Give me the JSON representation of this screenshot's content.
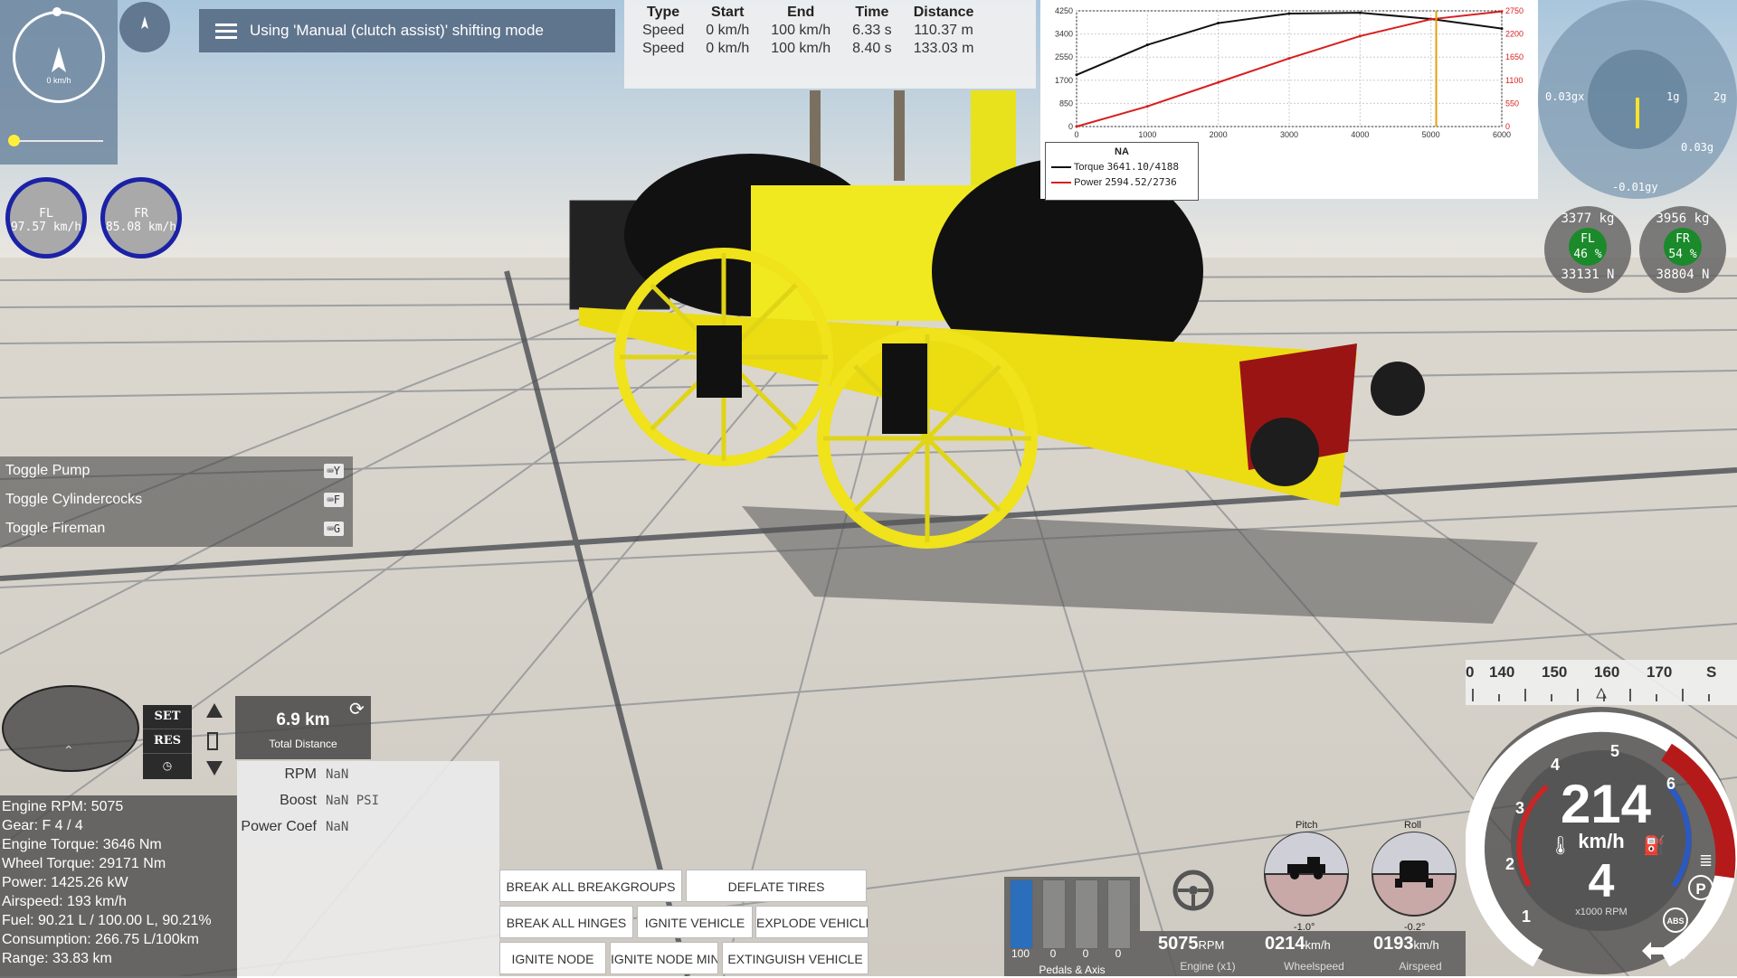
{
  "minimap": {
    "speed": "0 km/h"
  },
  "shift_banner": {
    "text": "Using 'Manual (clutch assist)' shifting mode"
  },
  "wheel_speeds": [
    {
      "label": "FL",
      "value": "97.57 km/h"
    },
    {
      "label": "FR",
      "value": "85.08 km/h"
    }
  ],
  "perf_table": {
    "headers": [
      "Type",
      "Start",
      "End",
      "Time",
      "Distance"
    ],
    "rows": [
      [
        "Speed",
        "0 km/h",
        "100 km/h",
        "6.33 s",
        "110.37 m"
      ],
      [
        "Speed",
        "0 km/h",
        "100 km/h",
        "8.40 s",
        "133.03 m"
      ]
    ]
  },
  "chart_data": {
    "type": "line",
    "title": "",
    "x": [
      0,
      1000,
      2000,
      3000,
      4000,
      5000,
      6000
    ],
    "xlim": [
      0,
      6000
    ],
    "ylim_left": [
      0,
      4250
    ],
    "ylim_right": [
      0,
      2750
    ],
    "left_ticks": [
      "4250",
      "3400",
      "2550",
      "1700",
      "850",
      "0"
    ],
    "right_ticks": [
      "2750",
      "2200",
      "1650",
      "1100",
      "550",
      "0"
    ],
    "x_ticks": [
      "0",
      "1000",
      "2000",
      "3000",
      "4000",
      "5000",
      "6000"
    ],
    "series": [
      {
        "name": "Torque",
        "color": "#111111",
        "values": [
          1900,
          3000,
          3800,
          4150,
          4180,
          3950,
          3600
        ]
      },
      {
        "name": "Power",
        "color": "#d81e1e",
        "values": [
          0,
          480,
          1050,
          1620,
          2150,
          2550,
          2736
        ]
      }
    ],
    "marker_rpm": 5075,
    "legend": {
      "title": "NA",
      "entries": [
        {
          "label": "Torque",
          "value": "3641.10/4188",
          "color": "#111111"
        },
        {
          "label": "Power",
          "value": "2594.52/2736",
          "color": "#d81e1e"
        }
      ]
    }
  },
  "gmeter": {
    "left": "0.03gx",
    "mid": "1g",
    "right": "2g",
    "inner": "0.03g",
    "bottom": "-0.01gy"
  },
  "tire_loads": [
    {
      "weight": "3377 kg",
      "label": "FL",
      "pct": "46 %",
      "force": "33131 N"
    },
    {
      "weight": "3956 kg",
      "label": "FR",
      "pct": "54 %",
      "force": "38804 N"
    }
  ],
  "actions": [
    {
      "label": "Toggle Pump",
      "key": "Y"
    },
    {
      "label": "Toggle Cylindercocks",
      "key": "F"
    },
    {
      "label": "Toggle Fireman",
      "key": "G"
    }
  ],
  "cruise": {
    "set": "SET",
    "res": "RES"
  },
  "total_distance": {
    "value": "6.9 km",
    "label": "Total Distance"
  },
  "engine_panel": [
    {
      "key": "RPM",
      "value": "NaN"
    },
    {
      "key": "Boost",
      "value": "NaN PSI"
    },
    {
      "key": "Power Coef",
      "value": "NaN"
    }
  ],
  "stats": [
    "Engine RPM: 5075",
    "Gear: F 4 / 4",
    "Engine Torque: 3646 Nm",
    "Wheel Torque: 29171 Nm",
    "Power: 1425.26 kW",
    "Airspeed: 193 km/h",
    "Fuel: 90.21 L / 100.00 L, 90.21%",
    "Consumption: 266.75 L/100km",
    "Range: 33.83 km"
  ],
  "buttons": {
    "break_all_breakgroups": "BREAK ALL BREAKGROUPS",
    "deflate_tires": "DEFLATE TIRES",
    "break_all_hinges": "BREAK ALL HINGES",
    "ignite_vehicle": "IGNITE VEHICLE",
    "explode_vehicle": "EXPLODE VEHICLE",
    "ignite_node": "IGNITE NODE",
    "ignite_node_min": "IGNITE NODE MIN",
    "extinguish_vehicle": "EXTINGUISH VEHICLE"
  },
  "attitude": {
    "pitch_label": "Pitch",
    "pitch_value": "-1.0°",
    "roll_label": "Roll",
    "roll_value": "-0.2°"
  },
  "pedals": {
    "values": [
      "100",
      "0",
      "0",
      "0"
    ],
    "fill": [
      1.0,
      0,
      0,
      0
    ],
    "label": "Pedals & Axis"
  },
  "bottom_readouts": {
    "rpm": "5075",
    "rpm_unit": "RPM",
    "rpm_label": "Engine (x1)",
    "wheelspeed": "0214",
    "wheelspeed_unit": "km/h",
    "wheelspeed_label": "Wheelspeed",
    "airspeed": "0193",
    "airspeed_unit": "km/h",
    "airspeed_label": "Airspeed"
  },
  "compass_strip": [
    "0",
    "140",
    "150",
    "160",
    "170",
    "S"
  ],
  "gauge": {
    "speed": "214",
    "unit": "km/h",
    "gear": "4",
    "rpm_label": "x1000 RPM",
    "ticks": [
      "1",
      "2",
      "3",
      "4",
      "5",
      "6"
    ],
    "park": "P",
    "abs": "ABS"
  }
}
